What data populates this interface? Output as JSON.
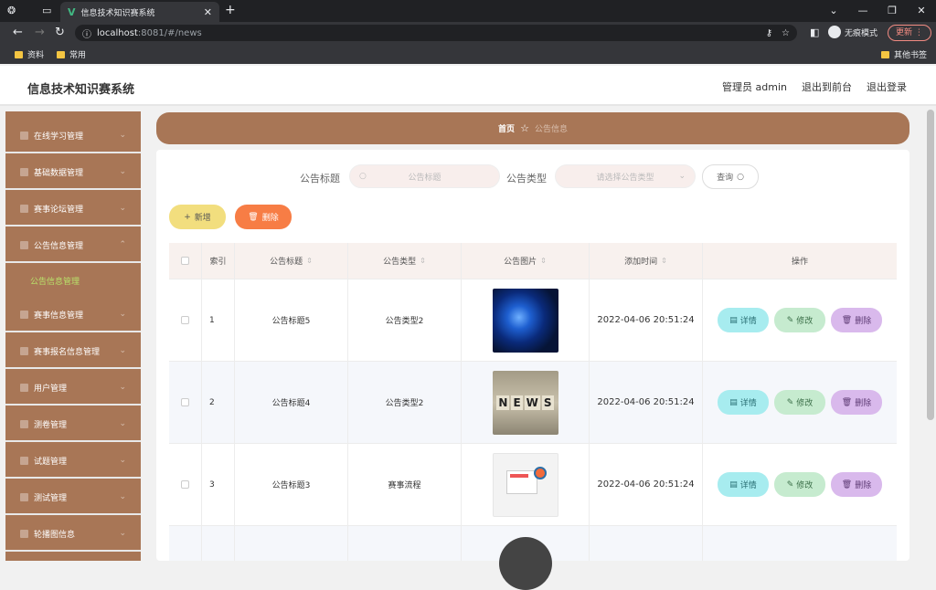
{
  "browser": {
    "tab_title": "信息技术知识赛系统",
    "url_host": "localhost",
    "url_path": ":8081/#/news",
    "incognito_label": "无痕模式",
    "update_label": "更新",
    "bookmarks": [
      "资料",
      "常用"
    ],
    "other_bookmarks": "其他书签"
  },
  "header": {
    "title": "信息技术知识赛系统",
    "user": "管理员 admin",
    "to_front": "退出到前台",
    "logout": "退出登录"
  },
  "sidebar": {
    "items": [
      "在线学习管理",
      "基础数据管理",
      "赛事论坛管理",
      "公告信息管理",
      "赛事信息管理",
      "赛事报名信息管理",
      "用户管理",
      "测卷管理",
      "试题管理",
      "测试管理",
      "轮播图信息"
    ],
    "sub_active": "公告信息管理"
  },
  "breadcrumb": {
    "home": "首页",
    "current": "公告信息"
  },
  "filters": {
    "title_label": "公告标题",
    "title_placeholder": "公告标题",
    "type_label": "公告类型",
    "type_placeholder": "请选择公告类型",
    "query": "查询"
  },
  "actions": {
    "add": "新增",
    "delete": "删除"
  },
  "table": {
    "headers": [
      "索引",
      "公告标题",
      "公告类型",
      "公告图片",
      "添加时间",
      "操作"
    ],
    "rows": [
      {
        "index": "1",
        "title": "公告标题5",
        "type": "公告类型2",
        "time": "2022-04-06 20:51:24"
      },
      {
        "index": "2",
        "title": "公告标题4",
        "type": "公告类型2",
        "time": "2022-04-06 20:51:24"
      },
      {
        "index": "3",
        "title": "公告标题3",
        "type": "赛事流程",
        "time": "2022-04-06 20:51:24"
      }
    ],
    "op_detail": "详情",
    "op_edit": "修改",
    "op_delete": "删除"
  },
  "colors": {
    "accent": "#a87656",
    "active_sub": "#b9e26a",
    "add_btn": "#f2de7e",
    "delete_btn": "#f77d45",
    "detail_btn": "#a7ecef",
    "edit_btn": "#c6ebcf",
    "op_delete_btn": "#d9b9ec"
  }
}
